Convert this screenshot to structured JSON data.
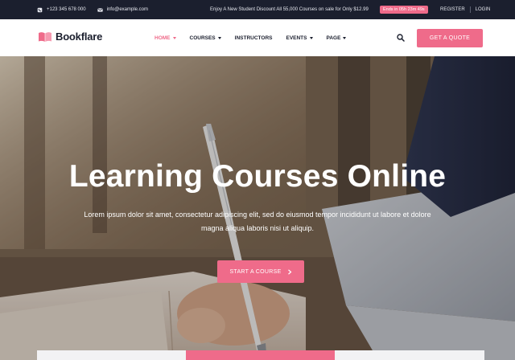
{
  "topbar": {
    "phone": "+123 345 678 000",
    "email": "info@example.com",
    "promo": "Enjoy A New Student Discount All 55,000 Courses on sale for Only $12.99",
    "timer": "Ends in 05h 23m 49s",
    "register": "REGISTER",
    "login": "LOGIN"
  },
  "header": {
    "logo_text": "Bookflare",
    "nav": [
      {
        "label": "HOME"
      },
      {
        "label": "COURSES"
      },
      {
        "label": "INSTRUCTORS"
      },
      {
        "label": "EVENTS"
      },
      {
        "label": "PAGE"
      }
    ],
    "cta": "GET A QUOTE"
  },
  "hero": {
    "title": "Learning Courses Online",
    "subtitle": "Lorem ipsum dolor sit amet, consectetur adipiscing elit, sed do eiusmod tempor incididunt ut labore et dolore magna aliqua laboris nisi ut aliquip.",
    "cta": "START A COURSE"
  },
  "colors": {
    "accent": "#ef6b8a",
    "dark": "#1b1f2e"
  }
}
